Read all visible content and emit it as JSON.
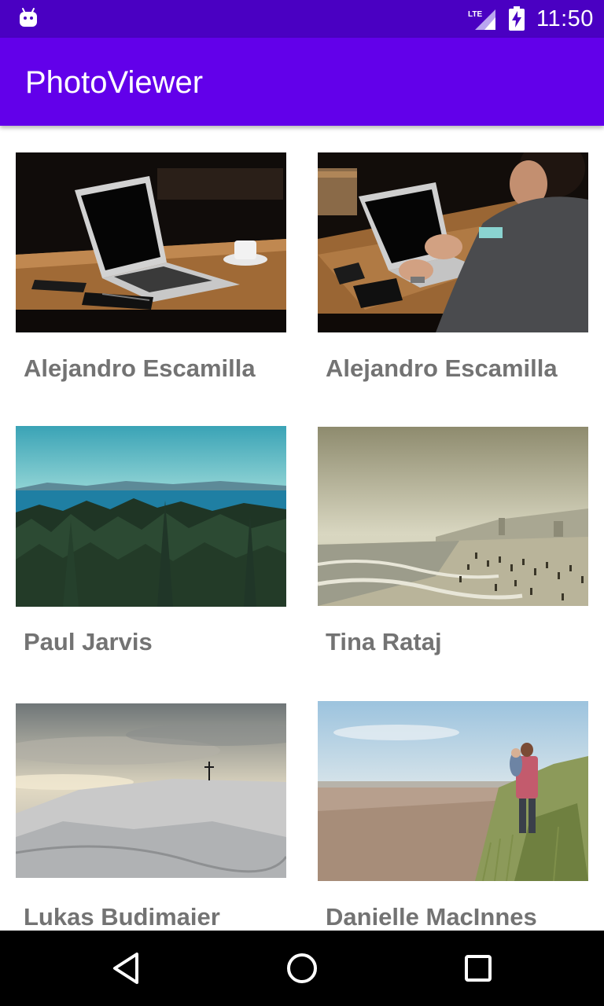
{
  "status_bar": {
    "time": "11:50",
    "network_label": "LTE",
    "icons": [
      "android-icon",
      "lte-signal-icon",
      "battery-charging-icon"
    ]
  },
  "app_bar": {
    "title": "PhotoViewer"
  },
  "photos": [
    {
      "author": "Alejandro Escamilla",
      "image": "laptop-on-wooden-table-photo"
    },
    {
      "author": "Alejandro Escamilla",
      "image": "man-typing-on-laptop-photo"
    },
    {
      "author": "Paul Jarvis",
      "image": "forest-and-lake-photo"
    },
    {
      "author": "Tina Rataj",
      "image": "hazy-beach-crowd-photo"
    },
    {
      "author": "Lukas Budimaier",
      "image": "snowy-hill-cross-photo"
    },
    {
      "author": "Danielle MacInnes",
      "image": "father-child-beach-photo"
    }
  ],
  "nav_bar": {
    "buttons": [
      "back-icon",
      "home-icon",
      "recents-icon"
    ]
  },
  "colors": {
    "status_bar": "#4a00c2",
    "app_bar": "#6200ea",
    "author_text": "#737373",
    "nav_bar": "#000000"
  }
}
